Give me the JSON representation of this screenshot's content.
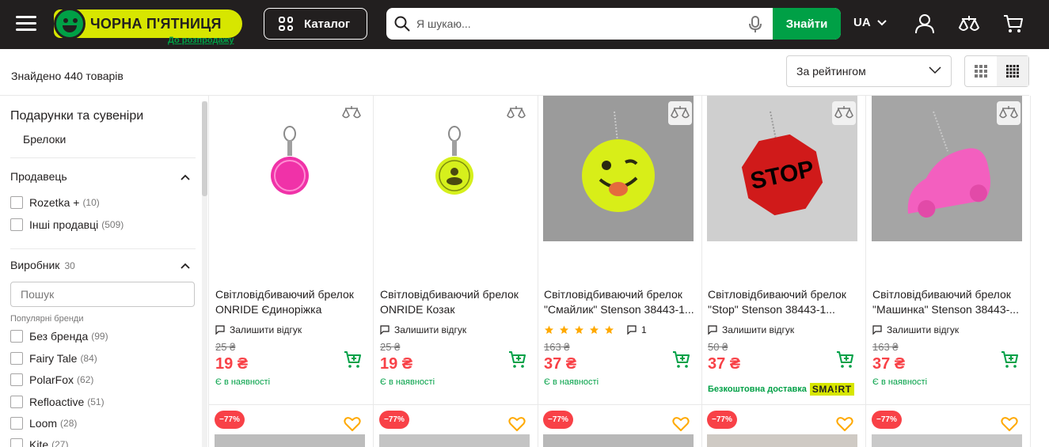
{
  "header": {
    "logo_text": "ЧОРНА П'ЯТНИЦЯ",
    "logo_sub": "До розпродажу",
    "catalog_label": "Каталог",
    "search_placeholder": "Я шукаю...",
    "search_button": "Знайти",
    "lang": "UA"
  },
  "toolbar": {
    "found": "Знайдено 440 товарів",
    "sort_value": "За рейтингом"
  },
  "sidebar": {
    "category": "Подарунки та сувеніри",
    "subcategory": "Брелоки",
    "seller_title": "Продавець",
    "sellers": [
      {
        "label": "Rozetka +",
        "count": "(10)"
      },
      {
        "label": "Інші продавці",
        "count": "(509)"
      }
    ],
    "brand_title": "Виробник",
    "brand_count": "30",
    "brand_search_placeholder": "Пошук",
    "popular_label": "Популярні бренди",
    "brands": [
      {
        "label": "Без бренда",
        "count": "(99)"
      },
      {
        "label": "Fairy Tale",
        "count": "(84)"
      },
      {
        "label": "PolarFox",
        "count": "(62)"
      },
      {
        "label": "Refloactive",
        "count": "(51)"
      },
      {
        "label": "Loom",
        "count": "(28)"
      },
      {
        "label": "Kite",
        "count": "(27)"
      }
    ]
  },
  "products": [
    {
      "title": "Світловідбиваючий брелок ONRIDE Єдиноріжка",
      "review": "Залишити відгук",
      "old_price": "25 ₴",
      "price": "19 ₴",
      "status": "Є в наявності",
      "image": "pink-round-reflector"
    },
    {
      "title": "Світловідбиваючий брелок ONRIDE Козак",
      "review": "Залишити відгук",
      "old_price": "25 ₴",
      "price": "19 ₴",
      "status": "Є в наявності",
      "image": "yellow-round-reflector"
    },
    {
      "title": "Світловідбиваючий брелок \"Смайлик\" Stenson 38443-1...",
      "rating": 5,
      "review_count": "1",
      "old_price": "163 ₴",
      "price": "37 ₴",
      "status": "Є в наявності",
      "image": "smiley-reflector"
    },
    {
      "title": "Світловідбиваючий брелок \"Stop\" Stenson 38443-1...",
      "review": "Залишити відгук",
      "old_price": "50 ₴",
      "price": "37 ₴",
      "delivery": "Безкоштовна доставка",
      "delivery_badge": "SMA!RT",
      "image": "stop-sign-reflector",
      "image_text": "STOP"
    },
    {
      "title": "Світловідбиваючий брелок \"Машинка\" Stenson 38443-...",
      "review": "Залишити відгук",
      "old_price": "163 ₴",
      "price": "37 ₴",
      "status": "Є в наявності",
      "image": "pink-car-reflector"
    }
  ],
  "next_row": {
    "discount": "−77%"
  },
  "colors": {
    "header_bg": "#221f1f",
    "accent_green": "#00a046",
    "price_red": "#f84147",
    "logo_yellow": "#d7e600",
    "star": "#ffa900"
  }
}
